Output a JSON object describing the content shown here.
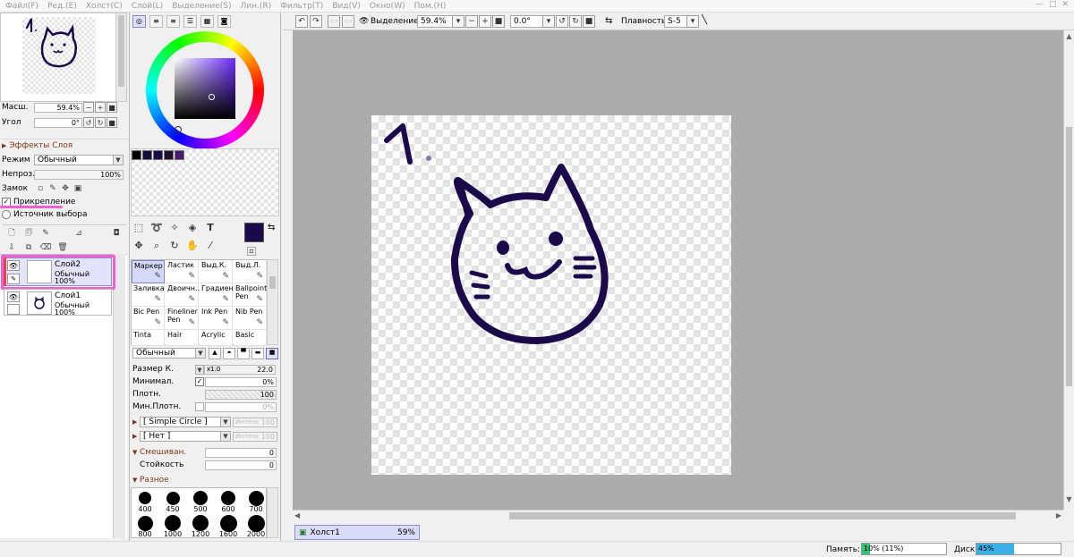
{
  "menu": [
    "Файл(F)",
    "Ред.(E)",
    "Холст(C)",
    "Слой(L)",
    "Выделение(S)",
    "Лин.(R)",
    "Фильтр(T)",
    "Вид(V)",
    "Окно(W)",
    "Пом.(H)"
  ],
  "window_controls": [
    "—",
    "□",
    "✕"
  ],
  "navigator": {
    "zoom_label": "Масш.",
    "zoom_value": "59.4%",
    "angle_label": "Угол",
    "angle_value": "0°"
  },
  "layer_effects": {
    "header": "Эффекты Слоя",
    "mode_label": "Режим",
    "mode_value": "Обычный",
    "opacity_label": "Непроз.",
    "opacity_value": "100%",
    "lock_label": "Замок",
    "clipping_label": "Прикрепление",
    "clipping_checked": true,
    "selection_source_label": "Источник выбора"
  },
  "layers": [
    {
      "name": "Слой2",
      "mode": "Обычный",
      "opacity": "100%",
      "selected": true
    },
    {
      "name": "Слой1",
      "mode": "Обычный",
      "opacity": "100%",
      "selected": false
    }
  ],
  "color": {
    "current": "#1b0a4a",
    "swatches": [
      "#000000",
      "#140e3a",
      "#1b0a4a",
      "#1f1030",
      "#4a1a6e"
    ]
  },
  "brushes": [
    {
      "name": "Маркер",
      "icon": "marker-icon",
      "selected": true
    },
    {
      "name": "Ластик",
      "icon": "eraser-icon",
      "selected": false
    },
    {
      "name": "Выд.К.",
      "icon": "select-pen-icon",
      "selected": false
    },
    {
      "name": "Выд.Л.",
      "icon": "select-eraser-icon",
      "selected": false
    },
    {
      "name": "Заливка",
      "icon": "bucket-icon",
      "selected": false
    },
    {
      "name": "Двоичн...",
      "icon": "binary-pen-icon",
      "selected": false
    },
    {
      "name": "Градиент",
      "icon": "gradient-icon",
      "selected": false
    },
    {
      "name": "Ballpoint Pen",
      "icon": "ballpoint-icon",
      "selected": false
    },
    {
      "name": "Bic Pen",
      "icon": "pen-icon",
      "selected": false
    },
    {
      "name": "Fineliner Pen",
      "icon": "fineliner-icon",
      "selected": false
    },
    {
      "name": "Ink Pen",
      "icon": "ink-pen-icon",
      "selected": false
    },
    {
      "name": "Nib Pen",
      "icon": "nib-pen-icon",
      "selected": false
    },
    {
      "name": "Tinta",
      "icon": "",
      "selected": false
    },
    {
      "name": "Hair",
      "icon": "",
      "selected": false
    },
    {
      "name": "Acrylic",
      "icon": "",
      "selected": false
    },
    {
      "name": "Basic",
      "icon": "",
      "selected": false
    }
  ],
  "brush_settings": {
    "blend_mode": "Обычный",
    "size_label": "Размер К.",
    "size_multiplier": "x1.0",
    "size_value": "22.0",
    "min_size_label": "Минимал.",
    "min_size_value": "0%",
    "density_label": "Плотн.",
    "density_value": "100",
    "min_density_label": "Мин.Плотн.",
    "min_density_value": "0%",
    "shape": "[ Simple Circle ]",
    "shape_intensity_label": "Интенс",
    "shape_intensity_value": "100",
    "texture": "[ Нет ]",
    "texture_intensity_label": "Интенс",
    "texture_intensity_value": "100",
    "blending_label": "Смешиван.",
    "blending_value": "0",
    "persistence_label": "Стойкость",
    "persistence_value": "0",
    "misc_label": "Разное"
  },
  "brush_sizes": [
    "400",
    "450",
    "500",
    "600",
    "700",
    "800",
    "1000",
    "1200",
    "1600",
    "2000"
  ],
  "toolbar": {
    "selection_label": "Выделение",
    "zoom_value": "59.4%",
    "angle_value": "0.0°",
    "smoothing_label": "Плавность",
    "smoothing_value": "S-5"
  },
  "canvas_tab": {
    "name": "Холст1",
    "zoom": "59%"
  },
  "status": {
    "memory_label": "Память:",
    "memory_value": "10% (11%)",
    "memory_fraction": 0.1,
    "disk_label": "Диск:",
    "disk_value": "45%",
    "disk_fraction": 0.45
  },
  "artwork": {
    "number_text": "1.",
    "stroke_color": "#1b0a4a"
  }
}
